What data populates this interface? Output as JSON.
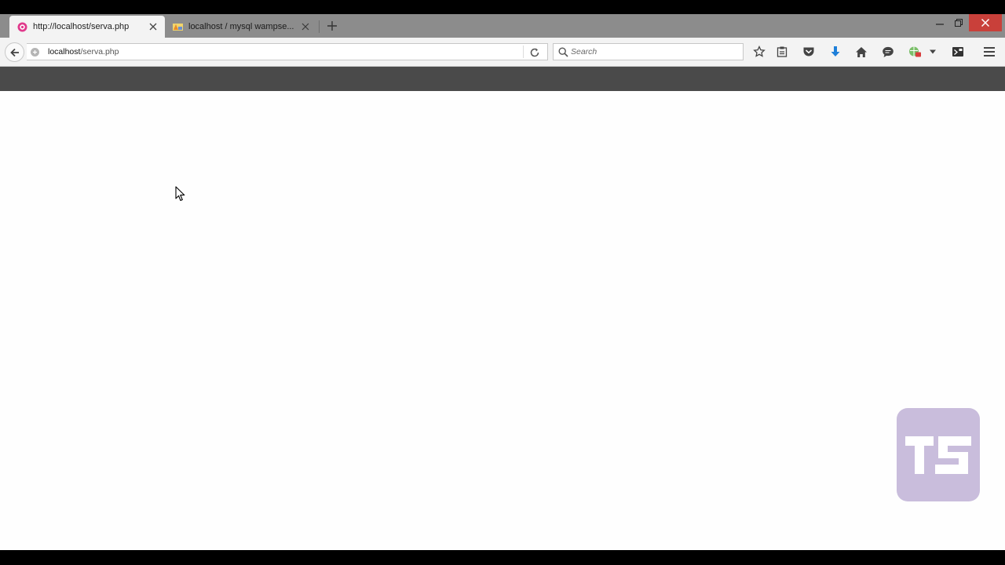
{
  "browser": {
    "tabs": [
      {
        "title": "http://localhost/serva.php",
        "active": true,
        "favicon": "wamp-favicon"
      },
      {
        "title": "localhost / mysql wampse...",
        "active": false,
        "favicon": "phpmyadmin-favicon"
      }
    ],
    "url": {
      "host": "localhost",
      "path": "/serva.php"
    },
    "search": {
      "placeholder": "Search"
    }
  },
  "colors": {
    "tabstrip": "#8c8c8c",
    "pagebar": "#4a4a4a",
    "close_button": "#c9403a",
    "download_arrow": "#1e7fd9",
    "watermark": "#c9bddc"
  },
  "icons": [
    "back-arrow-icon",
    "info-icon",
    "reload-icon",
    "search-icon",
    "bookmark-star-icon",
    "reading-list-icon",
    "pocket-icon",
    "downloads-icon",
    "home-icon",
    "chat-icon",
    "extension-icon",
    "dropdown-arrow-icon",
    "devtools-icon",
    "hamburger-menu-icon"
  ],
  "watermark": {
    "text": "TS"
  }
}
